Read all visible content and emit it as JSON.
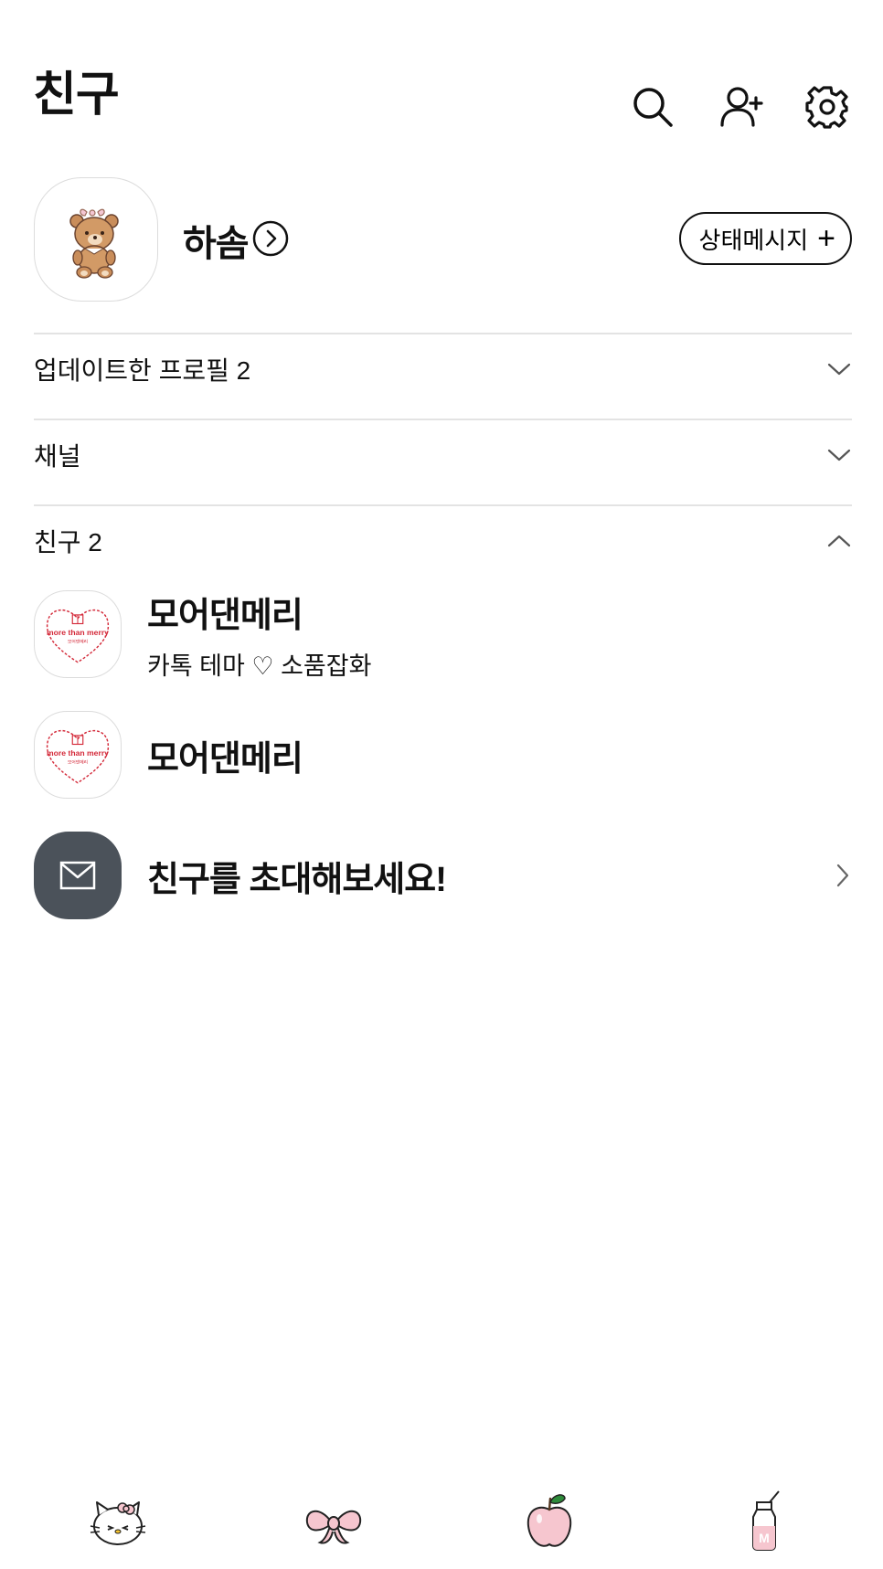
{
  "header": {
    "title": "친구",
    "icons": [
      "search-icon",
      "add-friend-icon",
      "settings-icon"
    ]
  },
  "profile": {
    "name": "하솜",
    "status_button_label": "상태메시지",
    "status_button_plus": "+"
  },
  "sections": {
    "updated_profiles": "업데이트한 프로필 2",
    "channel": "채널",
    "friends": "친구 2"
  },
  "friends": [
    {
      "name": "모어댄메리",
      "message": "카톡 테마 ♡ 소품잡화",
      "logo_text": "more than merry",
      "logo_sub": "모어댄메리"
    },
    {
      "name": "모어댄메리",
      "message": "",
      "logo_text": "more than merry",
      "logo_sub": "모어댄메리"
    }
  ],
  "invite": {
    "label": "친구를 초대해보세요!"
  },
  "tabs": [
    "hello-kitty-icon",
    "ribbon-icon",
    "apple-icon",
    "milk-bottle-icon"
  ],
  "colors": {
    "accent_red": "#d42a3a",
    "invite_bg": "#4b525a",
    "divider": "#e3e3e3",
    "tab_pink": "#f6c6cf"
  }
}
